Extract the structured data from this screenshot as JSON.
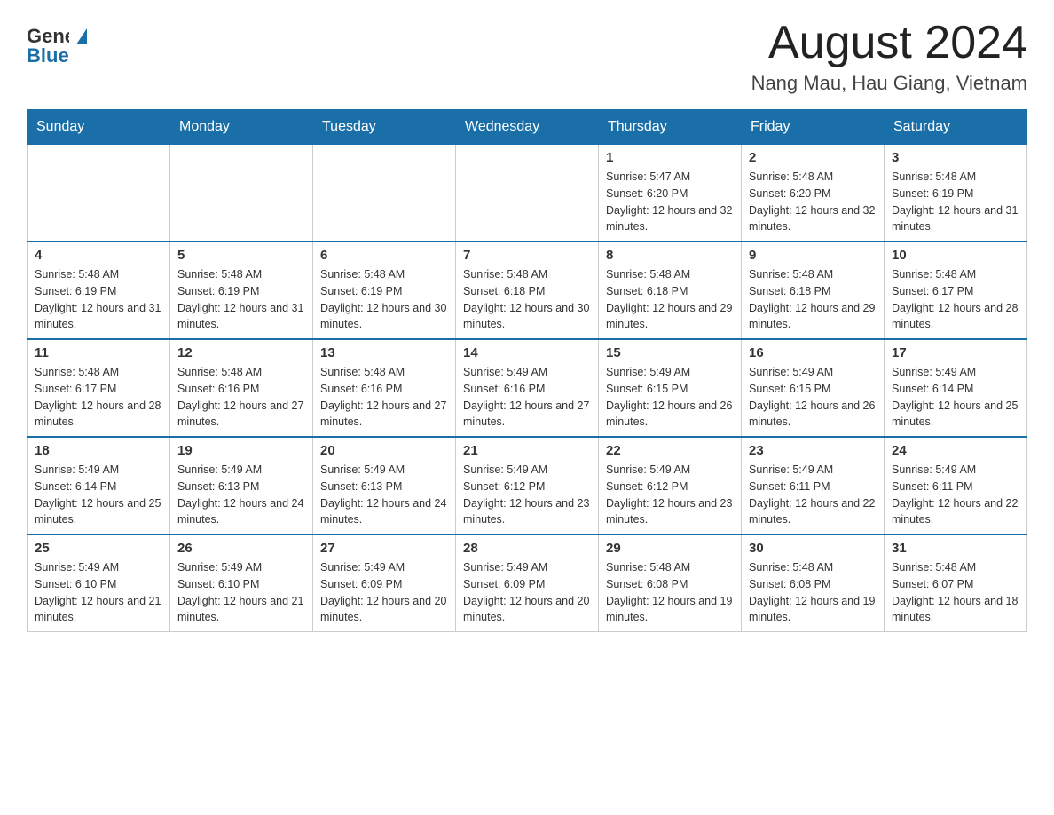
{
  "header": {
    "logo": {
      "general": "General",
      "blue": "Blue"
    },
    "title": "August 2024",
    "location": "Nang Mau, Hau Giang, Vietnam"
  },
  "days_of_week": [
    "Sunday",
    "Monday",
    "Tuesday",
    "Wednesday",
    "Thursday",
    "Friday",
    "Saturday"
  ],
  "weeks": [
    [
      {
        "day": "",
        "info": ""
      },
      {
        "day": "",
        "info": ""
      },
      {
        "day": "",
        "info": ""
      },
      {
        "day": "",
        "info": ""
      },
      {
        "day": "1",
        "info": "Sunrise: 5:47 AM\nSunset: 6:20 PM\nDaylight: 12 hours and 32 minutes."
      },
      {
        "day": "2",
        "info": "Sunrise: 5:48 AM\nSunset: 6:20 PM\nDaylight: 12 hours and 32 minutes."
      },
      {
        "day": "3",
        "info": "Sunrise: 5:48 AM\nSunset: 6:19 PM\nDaylight: 12 hours and 31 minutes."
      }
    ],
    [
      {
        "day": "4",
        "info": "Sunrise: 5:48 AM\nSunset: 6:19 PM\nDaylight: 12 hours and 31 minutes."
      },
      {
        "day": "5",
        "info": "Sunrise: 5:48 AM\nSunset: 6:19 PM\nDaylight: 12 hours and 31 minutes."
      },
      {
        "day": "6",
        "info": "Sunrise: 5:48 AM\nSunset: 6:19 PM\nDaylight: 12 hours and 30 minutes."
      },
      {
        "day": "7",
        "info": "Sunrise: 5:48 AM\nSunset: 6:18 PM\nDaylight: 12 hours and 30 minutes."
      },
      {
        "day": "8",
        "info": "Sunrise: 5:48 AM\nSunset: 6:18 PM\nDaylight: 12 hours and 29 minutes."
      },
      {
        "day": "9",
        "info": "Sunrise: 5:48 AM\nSunset: 6:18 PM\nDaylight: 12 hours and 29 minutes."
      },
      {
        "day": "10",
        "info": "Sunrise: 5:48 AM\nSunset: 6:17 PM\nDaylight: 12 hours and 28 minutes."
      }
    ],
    [
      {
        "day": "11",
        "info": "Sunrise: 5:48 AM\nSunset: 6:17 PM\nDaylight: 12 hours and 28 minutes."
      },
      {
        "day": "12",
        "info": "Sunrise: 5:48 AM\nSunset: 6:16 PM\nDaylight: 12 hours and 27 minutes."
      },
      {
        "day": "13",
        "info": "Sunrise: 5:48 AM\nSunset: 6:16 PM\nDaylight: 12 hours and 27 minutes."
      },
      {
        "day": "14",
        "info": "Sunrise: 5:49 AM\nSunset: 6:16 PM\nDaylight: 12 hours and 27 minutes."
      },
      {
        "day": "15",
        "info": "Sunrise: 5:49 AM\nSunset: 6:15 PM\nDaylight: 12 hours and 26 minutes."
      },
      {
        "day": "16",
        "info": "Sunrise: 5:49 AM\nSunset: 6:15 PM\nDaylight: 12 hours and 26 minutes."
      },
      {
        "day": "17",
        "info": "Sunrise: 5:49 AM\nSunset: 6:14 PM\nDaylight: 12 hours and 25 minutes."
      }
    ],
    [
      {
        "day": "18",
        "info": "Sunrise: 5:49 AM\nSunset: 6:14 PM\nDaylight: 12 hours and 25 minutes."
      },
      {
        "day": "19",
        "info": "Sunrise: 5:49 AM\nSunset: 6:13 PM\nDaylight: 12 hours and 24 minutes."
      },
      {
        "day": "20",
        "info": "Sunrise: 5:49 AM\nSunset: 6:13 PM\nDaylight: 12 hours and 24 minutes."
      },
      {
        "day": "21",
        "info": "Sunrise: 5:49 AM\nSunset: 6:12 PM\nDaylight: 12 hours and 23 minutes."
      },
      {
        "day": "22",
        "info": "Sunrise: 5:49 AM\nSunset: 6:12 PM\nDaylight: 12 hours and 23 minutes."
      },
      {
        "day": "23",
        "info": "Sunrise: 5:49 AM\nSunset: 6:11 PM\nDaylight: 12 hours and 22 minutes."
      },
      {
        "day": "24",
        "info": "Sunrise: 5:49 AM\nSunset: 6:11 PM\nDaylight: 12 hours and 22 minutes."
      }
    ],
    [
      {
        "day": "25",
        "info": "Sunrise: 5:49 AM\nSunset: 6:10 PM\nDaylight: 12 hours and 21 minutes."
      },
      {
        "day": "26",
        "info": "Sunrise: 5:49 AM\nSunset: 6:10 PM\nDaylight: 12 hours and 21 minutes."
      },
      {
        "day": "27",
        "info": "Sunrise: 5:49 AM\nSunset: 6:09 PM\nDaylight: 12 hours and 20 minutes."
      },
      {
        "day": "28",
        "info": "Sunrise: 5:49 AM\nSunset: 6:09 PM\nDaylight: 12 hours and 20 minutes."
      },
      {
        "day": "29",
        "info": "Sunrise: 5:48 AM\nSunset: 6:08 PM\nDaylight: 12 hours and 19 minutes."
      },
      {
        "day": "30",
        "info": "Sunrise: 5:48 AM\nSunset: 6:08 PM\nDaylight: 12 hours and 19 minutes."
      },
      {
        "day": "31",
        "info": "Sunrise: 5:48 AM\nSunset: 6:07 PM\nDaylight: 12 hours and 18 minutes."
      }
    ]
  ]
}
